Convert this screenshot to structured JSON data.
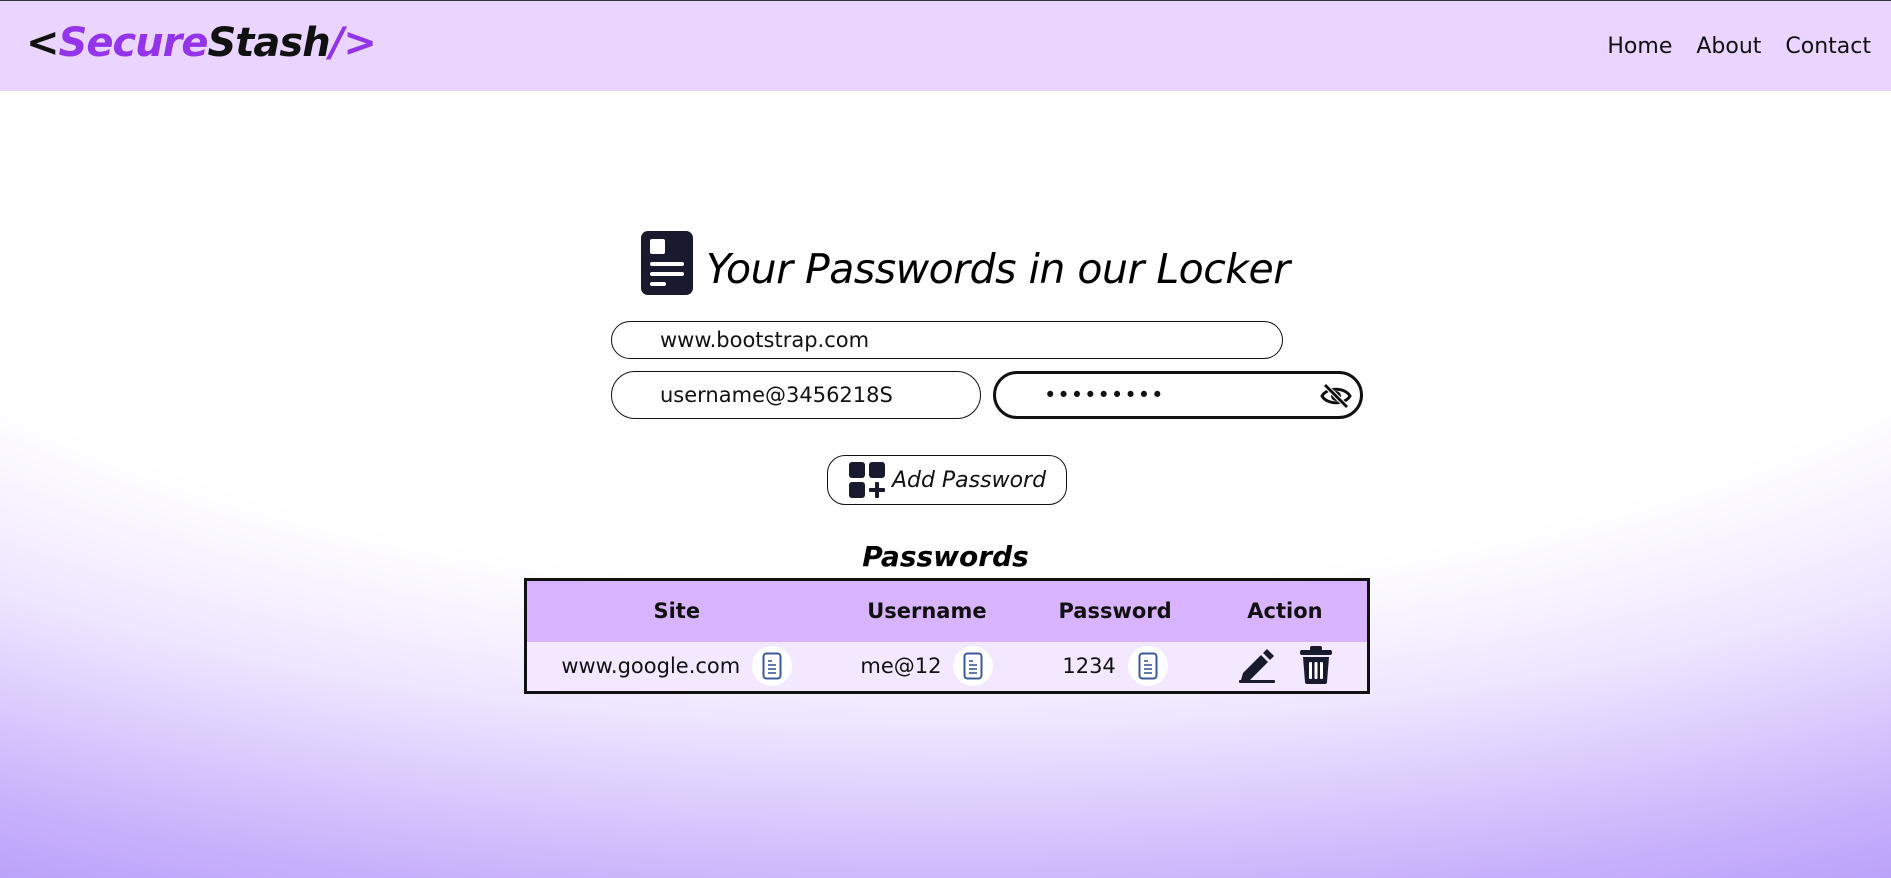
{
  "navbar": {
    "logo": {
      "open": "<",
      "part1": "Secure",
      "part2": "Stash",
      "part3": "/",
      "close": ">"
    },
    "links": [
      "Home",
      "About",
      "Contact"
    ]
  },
  "heading": {
    "title": "Your Passwords in our Locker",
    "icon": "document-icon"
  },
  "form": {
    "site_value": "www.bootstrap.com",
    "username_value": "username@3456218S",
    "password_value": "•••••••••",
    "toggle_icon": "eye-slash-icon",
    "add_button_label": "Add Password",
    "add_button_icon": "grid-plus-icon"
  },
  "passwords_section": {
    "title": "Passwords",
    "columns": [
      "Site",
      "Username",
      "Password",
      "Action"
    ],
    "rows": [
      {
        "site": "www.google.com",
        "username": "me@12",
        "password": "1234"
      }
    ]
  },
  "colors": {
    "navbar_bg": "#e9d5ff",
    "accent": "#9333ea",
    "table_header": "#d8b4fe",
    "table_row": "#f3e8ff"
  }
}
